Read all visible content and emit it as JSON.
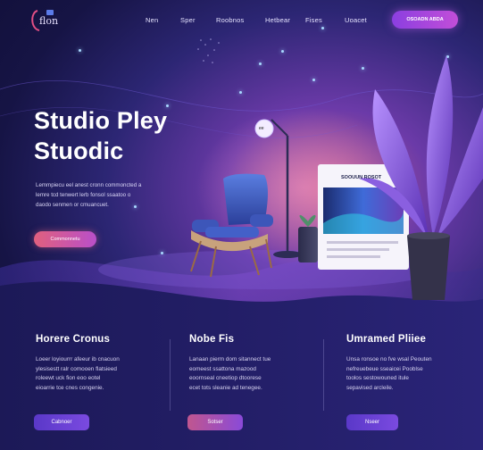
{
  "nav": {
    "logo_text": "flon",
    "items": [
      "Nen",
      "Sper",
      "Roobnos",
      "Hetbear",
      "Fises",
      "Uoacet"
    ],
    "cta_label": "OSOADN ABDA"
  },
  "hero": {
    "title_line1": "Studio Pley",
    "title_line2": "Stuodic",
    "description_lines": [
      "Lemmpiecu eel anest cronn commoncted a",
      "lemre tcd tenwert lerb fonsol ssaatoo o",
      "daodo senmen or cmuancuet."
    ],
    "button_label": "Commonnetu"
  },
  "scene": {
    "screen_title": "SOOUUN ROSOT",
    "lamp_label": "ee"
  },
  "cards": [
    {
      "title": "Horere Cronus",
      "body_lines": [
        "Loeer loyiourrr afeeur ib cnacuon",
        "ylesisestt ralr comooen flatsieed",
        "roleewt uck fion eoo eotel",
        "eioarrie tce cnes congenie."
      ],
      "button_label": "Cabnoer"
    },
    {
      "title": "Nobe Fis",
      "body_lines": [
        "Lanaan pierm dom sitannect tue",
        "eomeest ssattona mazood",
        "eoornseal cneetiop dtoorese",
        "ecet tots sleanie ad tenegee."
      ],
      "button_label": "Sotser"
    },
    {
      "title": "Umramed Pliiee",
      "body_lines": [
        "Unsa ronsoe no fve wsal Peouten",
        "nefreuebeue sseaicei Pooblse",
        "toolos sestowouned itule",
        "sepavised arcleile."
      ],
      "button_label": "Nseer"
    }
  ],
  "colors": {
    "background": "#120f3a",
    "accent_purple": "#8b3fe0",
    "accent_pink": "#e0607e"
  }
}
